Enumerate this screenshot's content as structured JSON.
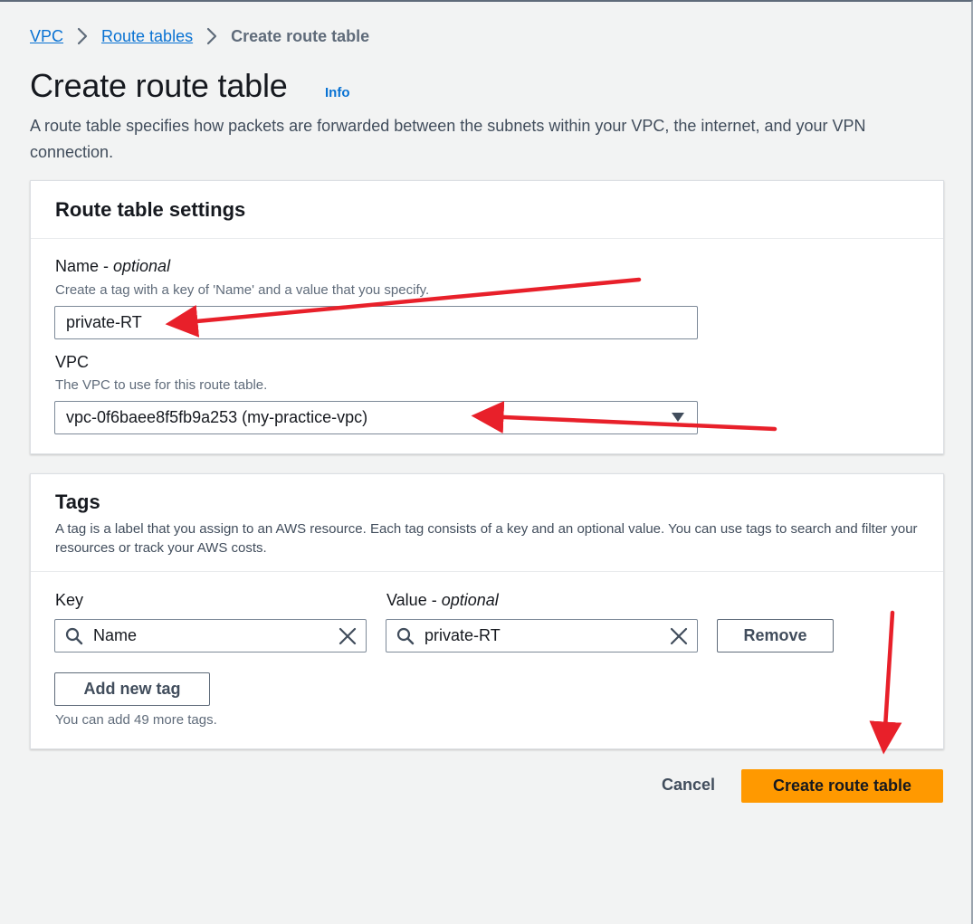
{
  "breadcrumb": {
    "items": [
      "VPC",
      "Route tables"
    ],
    "current": "Create route table"
  },
  "header": {
    "title": "Create route table",
    "info_label": "Info",
    "description": "A route table specifies how packets are forwarded between the subnets within your VPC, the internet, and your VPN connection."
  },
  "settings": {
    "title": "Route table settings",
    "name_label": "Name",
    "name_optional": "optional",
    "name_hint": "Create a tag with a key of 'Name' and a value that you specify.",
    "name_value": "private-RT",
    "vpc_label": "VPC",
    "vpc_hint": "The VPC to use for this route table.",
    "vpc_value": "vpc-0f6baee8f5fb9a253 (my-practice-vpc)"
  },
  "tags": {
    "title": "Tags",
    "description": "A tag is a label that you assign to an AWS resource. Each tag consists of a key and an optional value. You can use tags to search and filter your resources or track your AWS costs.",
    "key_label": "Key",
    "value_label": "Value",
    "value_optional": "optional",
    "rows": [
      {
        "key": "Name",
        "value": "private-RT"
      }
    ],
    "remove_label": "Remove",
    "add_label": "Add new tag",
    "remaining_text": "You can add 49 more tags."
  },
  "footer": {
    "cancel_label": "Cancel",
    "submit_label": "Create route table"
  },
  "colors": {
    "link": "#0972d3",
    "primary_button": "#ff9900",
    "annotation_arrow": "#e8202a"
  },
  "icons": [
    "chevron-right-icon",
    "search-icon",
    "close-icon",
    "caret-down-icon"
  ]
}
